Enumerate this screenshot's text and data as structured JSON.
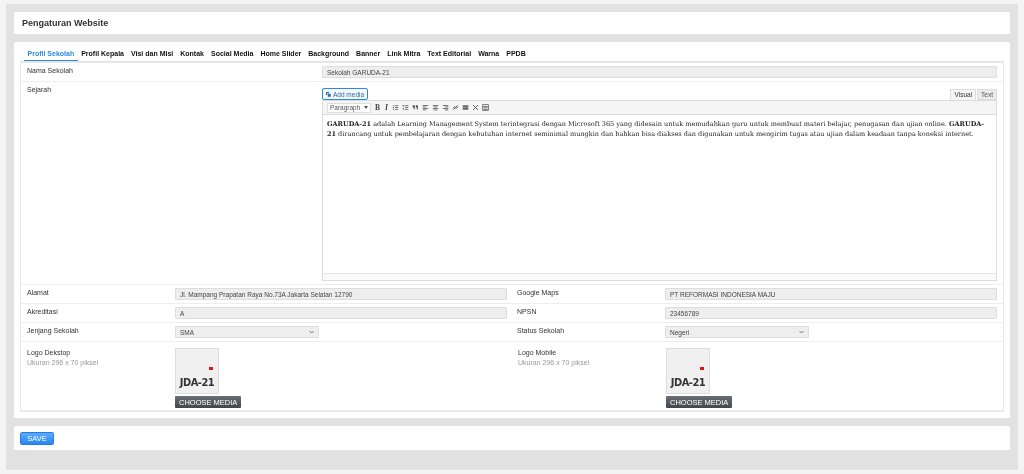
{
  "page_title": "Pengaturan Website",
  "tabs": [
    {
      "label": "Profil Sekolah",
      "selected": true
    },
    {
      "label": "Profil Kepala",
      "selected": false
    },
    {
      "label": "Visi dan Misi",
      "selected": false
    },
    {
      "label": "Kontak",
      "selected": false
    },
    {
      "label": "Social Media",
      "selected": false
    },
    {
      "label": "Home Slider",
      "selected": false
    },
    {
      "label": "Background",
      "selected": false
    },
    {
      "label": "Banner",
      "selected": false
    },
    {
      "label": "Link Mitra",
      "selected": false
    },
    {
      "label": "Text Editorial",
      "selected": false
    },
    {
      "label": "Warna",
      "selected": false
    },
    {
      "label": "PPDB",
      "selected": false
    }
  ],
  "nama_sekolah": {
    "label": "Nama Sekolah",
    "value": "Sekolah GARUDA-21"
  },
  "sejarah": {
    "label": "Sejarah",
    "add_media": "Add media",
    "format_select": "Paragraph",
    "editor_tabs": [
      {
        "label": "Visual",
        "selected": true
      },
      {
        "label": "Text",
        "selected": false
      }
    ],
    "toolbar": [
      {
        "kind": "bold",
        "label": "B"
      },
      {
        "kind": "italic",
        "label": "I"
      },
      {
        "kind": "bullets"
      },
      {
        "kind": "numbers"
      },
      {
        "kind": "quote"
      },
      {
        "kind": "align-left"
      },
      {
        "kind": "align-center"
      },
      {
        "kind": "align-right"
      },
      {
        "kind": "link"
      },
      {
        "kind": "more"
      },
      {
        "kind": "fullscreen"
      },
      {
        "kind": "toolbar-toggle"
      }
    ],
    "content": "**GARUDA-21** adalah Learning Management System terintegrasi dengan Microsoft 365 yang didesain untuk memudahkan guru untuk membuat materi belajar, penugasan dan ujian online. **GARUDA-21** dirancang untuk pembelajaran dengan kebutuhan internet seminimal mungkin dan bahkan bisa diakses dan digunakan untuk mengirim tugas atau ujian dalam keadaan tanpa koneksi internet."
  },
  "field_rows": [
    [
      {
        "label": "Alamat",
        "kind": "text",
        "value": "Jl. Mampang Prapatan Raya No.73A Jakarta Selatan 12790"
      },
      {
        "label": "Google Maps",
        "kind": "text",
        "value": "PT REFORMASI INDONESIA MAJU"
      }
    ],
    [
      {
        "label": "Akreditasi",
        "kind": "text",
        "value": "A"
      },
      {
        "label": "NPSN",
        "kind": "text",
        "value": "23456789"
      }
    ],
    [
      {
        "label": "Jenjang Sekolah",
        "kind": "select",
        "value": "SMA"
      },
      {
        "label": "Status Sekolah",
        "kind": "select",
        "value": "Negeri"
      }
    ]
  ],
  "logos": [
    {
      "label": "Logo Dekstop",
      "hint": "Ukuran 296 x 70 piksel",
      "image_text": "JDA-21",
      "button": "CHOOSE MEDIA"
    },
    {
      "label": "Logo Mobile",
      "hint": "Ukuran 296 x 70 piksel",
      "image_text": "JDA-21",
      "button": "CHOOSE MEDIA"
    }
  ],
  "save_button": "SAVE"
}
